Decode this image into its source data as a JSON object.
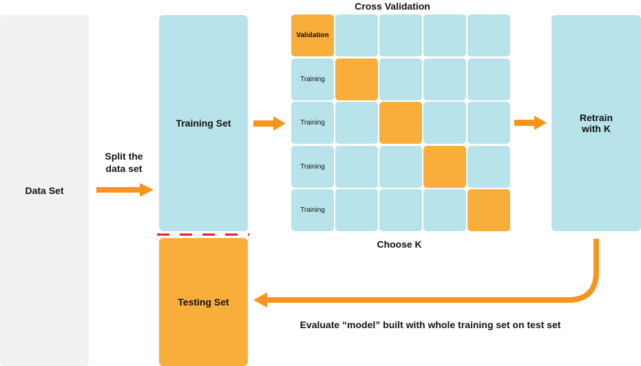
{
  "colors": {
    "data_set": "#f1f1f1",
    "training": "#b8e3ea",
    "validation_testing": "#f9ae3b",
    "arrow": "#f7941d",
    "split_line": "#e8131f"
  },
  "boxes": {
    "data_set": "Data Set",
    "training_set": "Training Set",
    "testing_set": "Testing Set",
    "retrain": [
      "Retrain",
      "with K"
    ]
  },
  "labels": {
    "split": [
      "Split the",
      "data set"
    ],
    "cross_validation": "Cross Validation",
    "choose_k": "Choose K",
    "evaluate": "Evaluate “model” built with whole training set on test set"
  },
  "cv_grid": {
    "folds": 5,
    "rows": [
      {
        "label": "Validation",
        "validation_fold": 0
      },
      {
        "label": "Training",
        "validation_fold": 1
      },
      {
        "label": "Training",
        "validation_fold": 2
      },
      {
        "label": "Training",
        "validation_fold": 3
      },
      {
        "label": "Training",
        "validation_fold": 4
      }
    ]
  }
}
